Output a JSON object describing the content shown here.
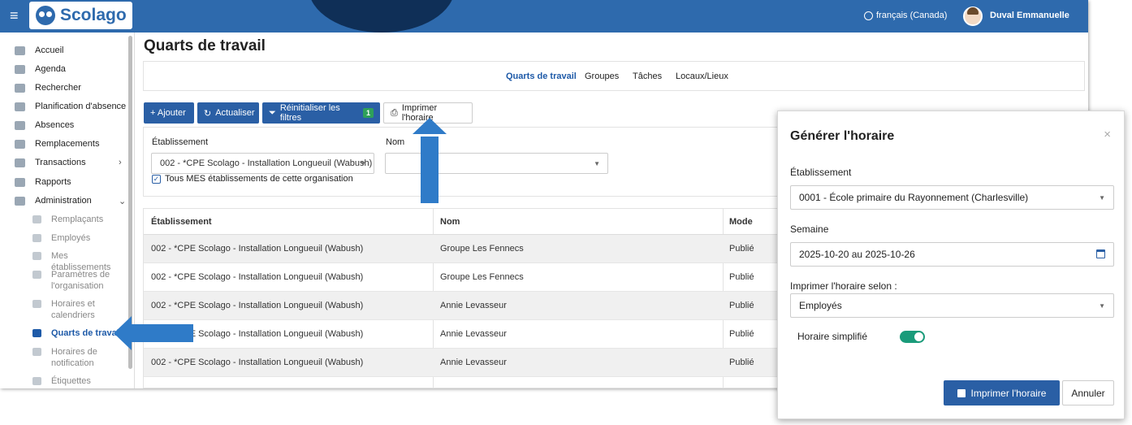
{
  "header": {
    "brand": "Scolago",
    "language": "français (Canada)",
    "user_name": "Duval Emmanuelle"
  },
  "sidebar": {
    "items": [
      {
        "label": "Accueil",
        "icon": "home-icon"
      },
      {
        "label": "Agenda",
        "icon": "calendar-icon"
      },
      {
        "label": "Rechercher",
        "icon": "search-icon"
      },
      {
        "label": "Planification d'absence",
        "icon": "calendar-icon"
      },
      {
        "label": "Absences",
        "icon": "users-icon"
      },
      {
        "label": "Remplacements",
        "icon": "swap-icon"
      },
      {
        "label": "Transactions",
        "icon": "card-icon",
        "chevron": "›"
      },
      {
        "label": "Rapports",
        "icon": "report-icon"
      },
      {
        "label": "Administration",
        "icon": "gear-icon",
        "chevron": "⌄"
      }
    ],
    "subitems": [
      {
        "label": "Remplaçants"
      },
      {
        "label": "Employés"
      },
      {
        "label": "Mes établissements"
      },
      {
        "label": "Paramètres de l'organisation"
      },
      {
        "label": "Horaires et calendriers"
      },
      {
        "label": "Quarts de travail",
        "active": true
      },
      {
        "label": "Horaires de notification"
      },
      {
        "label": "Étiquettes"
      }
    ]
  },
  "main": {
    "title": "Quarts de travail",
    "tabs": [
      {
        "label": "Quarts de travail",
        "active": true
      },
      {
        "label": "Groupes"
      },
      {
        "label": "Tâches"
      },
      {
        "label": "Locaux/Lieux"
      }
    ],
    "toolbar": {
      "add": "+ Ajouter",
      "refresh": "Actualiser",
      "reset_filters": "Réinitialiser les filtres",
      "reset_badge": "1",
      "print": "Imprimer l'horaire"
    },
    "filters": {
      "establishment_label": "Établissement",
      "establishment_value": "002 - *CPE Scolago - Installation Longueuil (Wabush)",
      "name_label": "Nom",
      "name_value": "",
      "all_checkbox_label": "Tous MES établissements de cette organisation"
    },
    "table": {
      "columns": [
        "Établissement",
        "Nom",
        "Mode"
      ],
      "rows": [
        [
          "002 - *CPE Scolago - Installation Longueuil (Wabush)",
          "Groupe Les Fennecs",
          "Publié"
        ],
        [
          "002 - *CPE Scolago - Installation Longueuil (Wabush)",
          "Groupe Les Fennecs",
          "Publié"
        ],
        [
          "002 - *CPE Scolago - Installation Longueuil (Wabush)",
          "Annie Levasseur",
          "Publié"
        ],
        [
          "002 - *CPE Scolago - Installation Longueuil (Wabush)",
          "Annie Levasseur",
          "Publié"
        ],
        [
          "002 - *CPE Scolago - Installation Longueuil (Wabush)",
          "Annie Levasseur",
          "Publié"
        ]
      ]
    }
  },
  "modal": {
    "title": "Générer l'horaire",
    "close": "×",
    "establishment_label": "Établissement",
    "establishment_value": "0001 - École primaire du Rayonnement (Charlesville)",
    "week_label": "Semaine",
    "week_value": "2025-10-20 au 2025-10-26",
    "print_by_label": "Imprimer l'horaire selon :",
    "print_by_value": "Employés",
    "simplified_label": "Horaire simplifié",
    "simplified_on": true,
    "print_button": "Imprimer l'horaire",
    "cancel_button": "Annuler"
  },
  "colors": {
    "brand_blue": "#2e6aad",
    "button_blue": "#2a5fa5",
    "arrow_blue": "#2f7bc8",
    "toggle_green": "#1a9b7a",
    "badge_green": "#2ea05a"
  }
}
